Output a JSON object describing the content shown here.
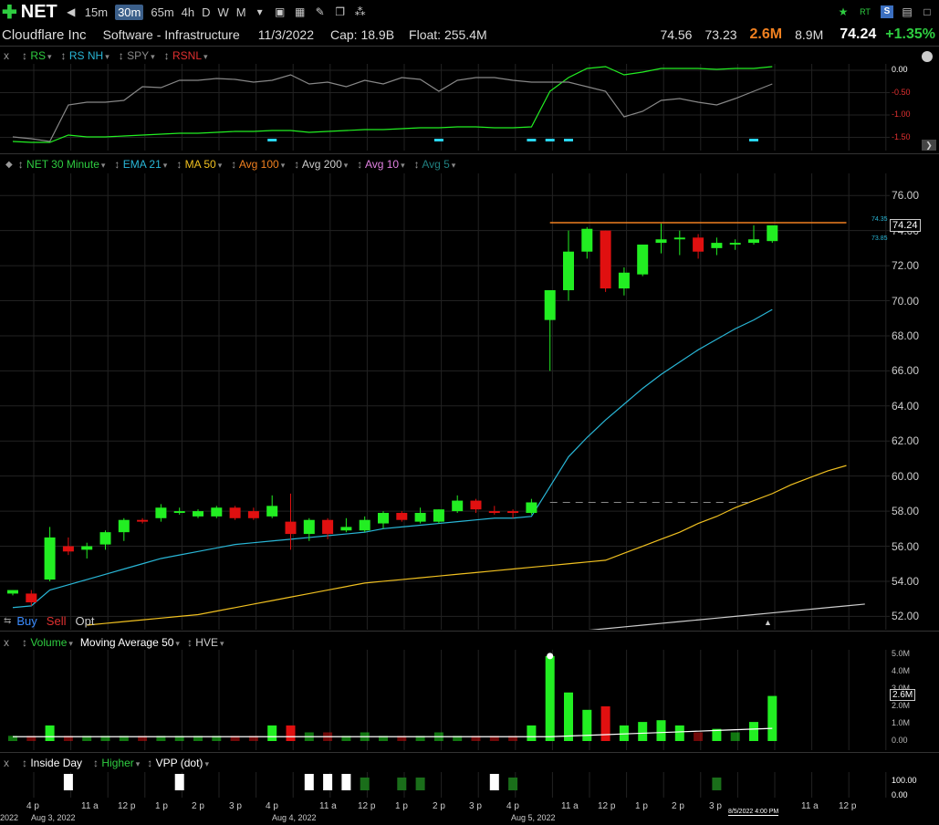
{
  "topbar": {
    "symbol": "NET",
    "timeframes": [
      "15m",
      "30m",
      "65m",
      "4h",
      "D",
      "W",
      "M"
    ],
    "active_timeframe": "30m",
    "right_icons": [
      "star-icon",
      "rt-icon",
      "s-icon",
      "save-icon",
      "window-icon"
    ],
    "rt_label": "RT",
    "s_label": "S"
  },
  "info": {
    "company": "Cloudflare Inc",
    "sector": "Software - Infrastructure",
    "date": "11/3/2022",
    "cap": "Cap: 18.9B",
    "float": "Float: 255.4M",
    "high": "74.56",
    "low": "73.23",
    "volume": "2.6M",
    "avg_volume": "8.9M",
    "last": "74.24",
    "change": "+1.35%"
  },
  "rs_pane": {
    "close": "x",
    "legend": [
      "RS",
      "RS NH",
      "SPY",
      "RSNL"
    ],
    "legend_colors": [
      "#2ecc40",
      "#29b6d6",
      "#888888",
      "#e03030"
    ],
    "axis_labels": [
      "0.00",
      "-0.50",
      "-1.00",
      "-1.50"
    ]
  },
  "price_pane": {
    "legend": [
      "NET 30 Minute",
      "EMA 21",
      "MA 50",
      "Avg 100",
      "Avg 200",
      "Avg 10",
      "Avg 5"
    ],
    "legend_colors": [
      "#2ecc40",
      "#29b6d6",
      "#f0c020",
      "#f08020",
      "#cccccc",
      "#e080e0",
      "#208080"
    ],
    "axis_labels": [
      "76.00",
      "74.00",
      "72.00",
      "70.00",
      "68.00",
      "66.00",
      "64.00",
      "62.00",
      "60.00",
      "58.00",
      "56.00",
      "54.00",
      "52.00"
    ],
    "last_price_box": "74.24",
    "hi_mark": "74.35",
    "lo_mark": "73.85",
    "orders": [
      "Buy",
      "Sell",
      "Opt"
    ]
  },
  "volume_pane": {
    "close": "x",
    "legend": [
      "Volume",
      "Moving Average 50",
      "HVE"
    ],
    "axis_labels": [
      "5.0M",
      "4.0M",
      "3.0M",
      "2.0M",
      "1.0M",
      "0.00"
    ],
    "last_box": "2.6M"
  },
  "inside_pane": {
    "close": "x",
    "legend": [
      "Inside Day",
      "Higher",
      "VPP (dot)"
    ],
    "axis_labels": [
      "100.00",
      "0.00"
    ]
  },
  "time_axis": {
    "ticks": [
      "4 p",
      "11 a",
      "12 p",
      "1 p",
      "2 p",
      "3 p",
      "4 p",
      "11 a",
      "12 p",
      "1 p",
      "2 p",
      "3 p",
      "4 p",
      "11 a",
      "12 p",
      "1 p",
      "2 p",
      "3 p",
      "11 a",
      "12 p"
    ],
    "dates": [
      "2022",
      "Aug 3, 2022",
      "Aug 4, 2022",
      "Aug 5, 2022"
    ],
    "stamp": "8/5/2022 4:00 PM"
  },
  "chart_data": {
    "type": "candlestick",
    "title": "NET 30 Minute",
    "ylim": [
      51.5,
      77
    ],
    "ohlc": [
      [
        53.3,
        53.5,
        53.2,
        53.5
      ],
      [
        53.3,
        53.5,
        52.6,
        52.8
      ],
      [
        54.1,
        57.1,
        54.0,
        56.5
      ],
      [
        56.0,
        56.5,
        55.5,
        55.7
      ],
      [
        55.8,
        56.2,
        55.3,
        56.0
      ],
      [
        56.1,
        56.9,
        55.8,
        56.8
      ],
      [
        56.8,
        57.6,
        56.3,
        57.5
      ],
      [
        57.5,
        57.6,
        57.3,
        57.4
      ],
      [
        57.6,
        58.4,
        57.4,
        58.2
      ],
      [
        57.9,
        58.2,
        57.8,
        58.0
      ],
      [
        57.7,
        58.1,
        57.6,
        58.0
      ],
      [
        57.7,
        58.3,
        57.6,
        58.2
      ],
      [
        58.2,
        58.3,
        57.5,
        57.6
      ],
      [
        58.0,
        58.2,
        57.5,
        57.6
      ],
      [
        57.7,
        58.9,
        57.6,
        58.3
      ],
      [
        57.4,
        59.0,
        55.8,
        56.7
      ],
      [
        56.7,
        57.6,
        56.3,
        57.5
      ],
      [
        57.5,
        57.6,
        56.4,
        56.7
      ],
      [
        56.9,
        57.6,
        56.8,
        57.1
      ],
      [
        56.9,
        57.7,
        56.8,
        57.5
      ],
      [
        57.3,
        58.0,
        57.0,
        57.9
      ],
      [
        57.9,
        58.0,
        57.4,
        57.5
      ],
      [
        57.4,
        58.2,
        57.3,
        57.9
      ],
      [
        57.4,
        58.1,
        57.3,
        58.1
      ],
      [
        58.0,
        58.9,
        57.9,
        58.6
      ],
      [
        58.6,
        58.7,
        57.9,
        58.1
      ],
      [
        58.0,
        58.3,
        57.8,
        57.9
      ],
      [
        58.0,
        58.1,
        57.6,
        57.9
      ],
      [
        57.9,
        58.7,
        57.8,
        58.5
      ],
      [
        68.9,
        70.5,
        66.0,
        70.6
      ],
      [
        70.6,
        74.0,
        70.0,
        72.8
      ],
      [
        72.8,
        74.2,
        72.4,
        74.1
      ],
      [
        74.0,
        74.0,
        70.5,
        70.7
      ],
      [
        70.7,
        71.9,
        70.3,
        71.6
      ],
      [
        71.5,
        73.2,
        71.4,
        73.2
      ],
      [
        73.3,
        74.4,
        72.7,
        73.5
      ],
      [
        73.5,
        74.0,
        72.6,
        73.6
      ],
      [
        73.6,
        73.8,
        72.4,
        72.8
      ],
      [
        73.0,
        73.6,
        72.6,
        73.3
      ],
      [
        73.2,
        73.5,
        72.9,
        73.3
      ],
      [
        73.3,
        74.3,
        73.2,
        73.5
      ],
      [
        73.4,
        74.3,
        73.3,
        74.3
      ]
    ],
    "ema21": [
      52.5,
      52.6,
      53.5,
      53.8,
      54.1,
      54.4,
      54.7,
      55.0,
      55.3,
      55.5,
      55.7,
      55.9,
      56.1,
      56.2,
      56.3,
      56.4,
      56.5,
      56.6,
      56.7,
      56.8,
      57.0,
      57.1,
      57.2,
      57.3,
      57.4,
      57.5,
      57.6,
      57.6,
      57.7,
      59.4,
      61.1,
      62.2,
      63.2,
      64.1,
      65.0,
      65.8,
      66.5,
      67.2,
      67.8,
      68.4,
      68.9,
      69.5
    ],
    "ma50": [
      51.5,
      51.6,
      51.7,
      51.8,
      51.9,
      52.0,
      52.1,
      52.3,
      52.5,
      52.7,
      52.9,
      53.1,
      53.3,
      53.5,
      53.7,
      53.9,
      54.0,
      54.1,
      54.2,
      54.3,
      54.4,
      54.5,
      54.6,
      54.7,
      54.8,
      54.9,
      55.0,
      55.1,
      55.2,
      55.6,
      56.0,
      56.4,
      56.8,
      57.3,
      57.7,
      58.2,
      58.6,
      59.0,
      59.5,
      59.9,
      60.3,
      60.6
    ],
    "avg200": [
      51.0,
      51.1,
      51.2,
      51.3,
      51.4,
      51.5,
      51.6,
      51.7,
      51.8,
      51.9,
      52.0,
      52.1,
      52.2,
      52.3,
      52.4,
      52.5,
      52.6,
      52.7
    ],
    "volume": [
      0.3,
      0.3,
      0.9,
      0.3,
      0.3,
      0.3,
      0.3,
      0.3,
      0.3,
      0.3,
      0.3,
      0.3,
      0.3,
      0.3,
      0.9,
      0.9,
      0.5,
      0.5,
      0.3,
      0.5,
      0.3,
      0.3,
      0.3,
      0.5,
      0.3,
      0.3,
      0.3,
      0.3,
      0.9,
      4.9,
      2.8,
      1.8,
      2.0,
      0.9,
      1.1,
      1.2,
      0.9,
      0.5,
      0.7,
      0.5,
      1.1,
      2.6
    ],
    "volume_unit": "M"
  }
}
